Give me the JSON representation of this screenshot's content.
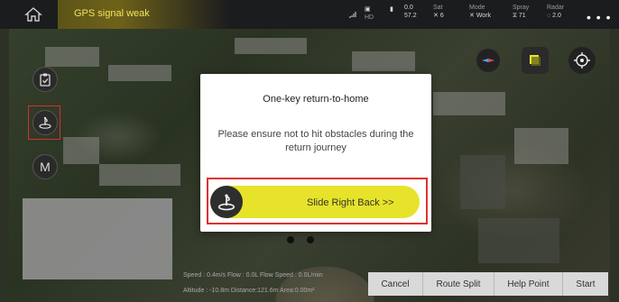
{
  "topbar": {
    "gps_warning": "GPS signal weak",
    "hd_label": "HD",
    "battery_top": "0.0",
    "battery_bottom": "57.2",
    "sat_label": "Sat",
    "sat_value": "6",
    "mode_label": "Mode",
    "mode_value": "Work",
    "spray_label": "Spray",
    "spray_value": "71",
    "radar_label": "Radar",
    "radar_value": "2.0",
    "more": "• • •"
  },
  "dialog": {
    "title": "One-key return-to-home",
    "message": "Please ensure not to hit obstacles during the return journey",
    "slider_label": "Slide Right Back >>"
  },
  "status": {
    "line1": "Speed : 0.4m/s   Flow : 0.0L   Flow Speed : 0.0L/min",
    "line2": "Altitude : -10.8m   Distance:121.6m   Area:0.00m²"
  },
  "bottom_buttons": [
    "Cancel",
    "Route Split",
    "Help Point",
    "Start"
  ],
  "sidebar": {
    "m_label": "M"
  },
  "colors": {
    "accent_yellow": "#e7e32a",
    "highlight_red": "#e03030",
    "warning_text": "#f3e35a"
  }
}
